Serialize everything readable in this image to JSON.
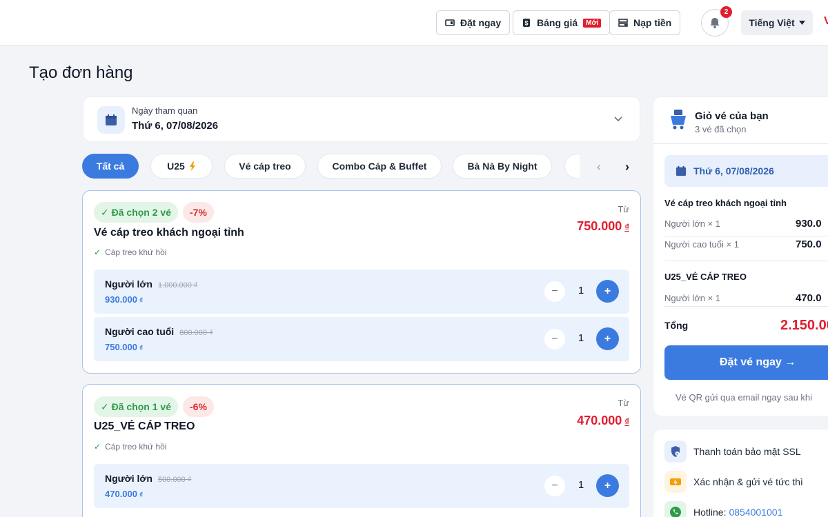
{
  "topbar": {
    "book_now": "Đặt ngay",
    "price_list": "Bảng giá",
    "new_badge": "Mới",
    "top_up": "Nạp tiền",
    "notification_count": "2",
    "language": "Tiếng Việt"
  },
  "page": {
    "title": "Tạo đơn hàng"
  },
  "visit_date": {
    "label": "Ngày tham quan",
    "value": "Thứ 6, 07/08/2026"
  },
  "filters": [
    {
      "label": "Tất cả",
      "active": true
    },
    {
      "label": "U25"
    },
    {
      "label": "Vé cáp treo"
    },
    {
      "label": "Combo Cáp & Buffet"
    },
    {
      "label": "Bà Nà By Night"
    }
  ],
  "tickets": [
    {
      "chosen": "✓ Đã chọn 2 vé",
      "discount": "-7%",
      "name": "Vé cáp treo khách ngoại tỉnh",
      "sub": "Cáp treo khứ hồi",
      "from_label": "Từ",
      "from_price": "750.000",
      "currency": "₫",
      "rows": [
        {
          "name": "Người lớn",
          "old_price": "1.000.000 ₫",
          "price": "930.000",
          "qty": "1"
        },
        {
          "name": "Người cao tuổi",
          "old_price": "800.000 ₫",
          "price": "750.000",
          "qty": "1"
        }
      ]
    },
    {
      "chosen": "✓ Đã chọn 1 vé",
      "discount": "-6%",
      "name": "U25_VÉ CÁP TREO",
      "sub": "Cáp treo khứ hồi",
      "from_label": "Từ",
      "from_price": "470.000",
      "currency": "₫",
      "rows": [
        {
          "name": "Người lớn",
          "old_price": "500.000 ₫",
          "price": "470.000",
          "qty": "1"
        }
      ]
    }
  ],
  "cart": {
    "title": "Giỏ vé của bạn",
    "count": "3 vé đã chọn",
    "date": "Thứ 6, 07/08/2026",
    "sections": [
      {
        "name": "Vé cáp treo khách ngoại tỉnh",
        "lines": [
          {
            "label": "Người lớn × 1",
            "amount": "930.0"
          },
          {
            "label": "Người cao tuổi × 1",
            "amount": "750.0"
          }
        ]
      },
      {
        "name": "U25_VÉ CÁP TREO",
        "lines": [
          {
            "label": "Người lớn × 1",
            "amount": "470.0"
          }
        ]
      }
    ],
    "total_label": "Tổng",
    "total_amount": "2.150.00",
    "book_button": "Đặt vé ngay →",
    "note": "Vé QR gửi qua email ngay sau khi"
  },
  "trust": {
    "ssl": "Thanh toán bảo mật SSL",
    "instant": "Xác nhận & gửi vé tức thì",
    "hotline_label": "Hotline:",
    "hotline_number": "0854001001"
  },
  "colors": {
    "primary": "#3b7be0",
    "price_red": "#e11d2e",
    "success_green": "#2e9a4a"
  }
}
